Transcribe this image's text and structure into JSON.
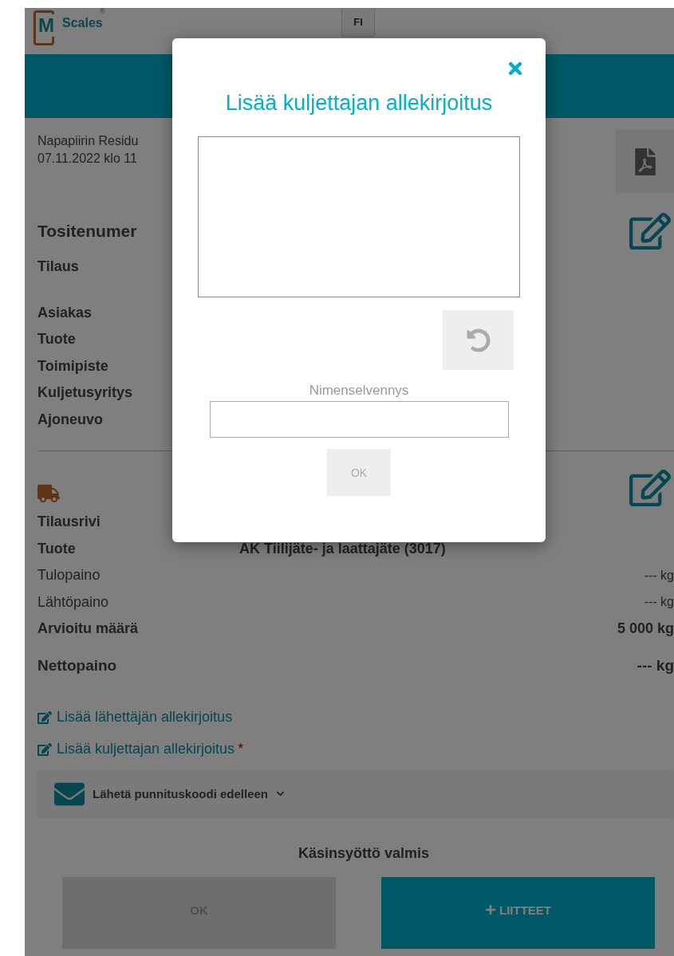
{
  "header": {
    "logo": {
      "letter": "M",
      "name": "Scales",
      "mark": "®"
    },
    "language": "FI"
  },
  "document": {
    "lines": [
      "Napapiirin Residu",
      "07.11.2022 klo 11"
    ]
  },
  "voucher": {
    "title": "Tositenumer",
    "order": "Tilaus",
    "fields": [
      "Asiakas",
      "Tuote",
      "Toimipiste",
      "Kuljetusyritys",
      "Ajoneuvo"
    ]
  },
  "weighing": {
    "rows": [
      {
        "label": "Tilausrivi",
        "kind": "item"
      },
      {
        "label": "Tuote",
        "value": "AK Tiilijäte- ja laattajäte (3017)",
        "kind": "item"
      },
      {
        "label": "Tulopaino",
        "value": "--- kg",
        "kind": "weight"
      },
      {
        "label": "Lähtöpaino",
        "value": "--- kg",
        "kind": "weight"
      },
      {
        "label": "Arvioitu määrä",
        "value": "5 000 kg",
        "kind": "estimate"
      },
      {
        "label": "Nettopaino",
        "value": "--- kg",
        "kind": "total"
      }
    ]
  },
  "signatures": [
    {
      "label": "Lisää lähettäjän allekirjoitus"
    },
    {
      "label": "Lisää kuljettajan allekirjoitus",
      "marker": "*"
    }
  ],
  "send": {
    "label": "Lähetä punnituskoodi edelleen",
    "expanded": false
  },
  "footer": {
    "title": "Käsinsyöttö valmis",
    "buttons": [
      {
        "label": "OK",
        "kind": "disabled"
      },
      {
        "label": "LIITTEET",
        "kind": "primary"
      }
    ]
  },
  "modal": {
    "title": "Lisää kuljettajan allekirjoitus",
    "name_label": "Nimenselvennys",
    "ok": {
      "label": "OK",
      "disabled": true
    }
  }
}
